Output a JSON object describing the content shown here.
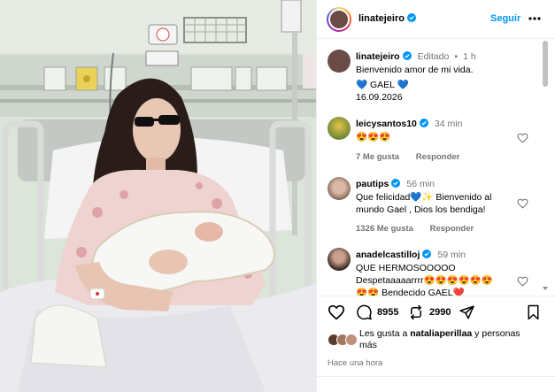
{
  "post": {
    "username": "linatejeiro",
    "follow_label": "Seguir"
  },
  "caption": {
    "username": "linatejeiro",
    "edited": "Editado",
    "dot": "•",
    "time": "1 h",
    "line1": "Bienvenido amor de mi vida.",
    "line2": "💙 GAEL 💙",
    "line3": "16.09.2026"
  },
  "comments": [
    {
      "username": "leicysantos10",
      "time": "34 min",
      "text": "😍😍😍",
      "likes": "7 Me gusta",
      "reply": "Responder"
    },
    {
      "username": "pautips",
      "time": "56 min",
      "text_line1": "Que felicidad💙✨ Bienvenido al",
      "text_line2": "mundo Gael , Dios los bendiga!",
      "likes": "1326 Me gusta",
      "reply": "Responder"
    },
    {
      "username": "anadelcastilloj",
      "time": "59 min",
      "text_line1": "QUE HERMOSOOOOO",
      "text_line2": "Despetaaaaarrrr😍😍😍😍😍😍",
      "text_line3": "😍😍 Bendecido GAEL❤️"
    }
  ],
  "actions": {
    "likes_count": "8955",
    "reposts_count": "2990"
  },
  "liked_by": {
    "prefix": "Les gusta a ",
    "user": "nataliaperillaa",
    "suffix": " y personas",
    "line2": "más"
  },
  "timestamp": "Hace una hora",
  "colors": {
    "accent": "#0095f6",
    "verified": "#0095f6",
    "muted": "#737373",
    "border": "#efefef"
  },
  "icons": [
    "more-icon",
    "verified-icon",
    "heart-icon",
    "comment-icon",
    "repost-icon",
    "share-icon",
    "bookmark-icon"
  ]
}
